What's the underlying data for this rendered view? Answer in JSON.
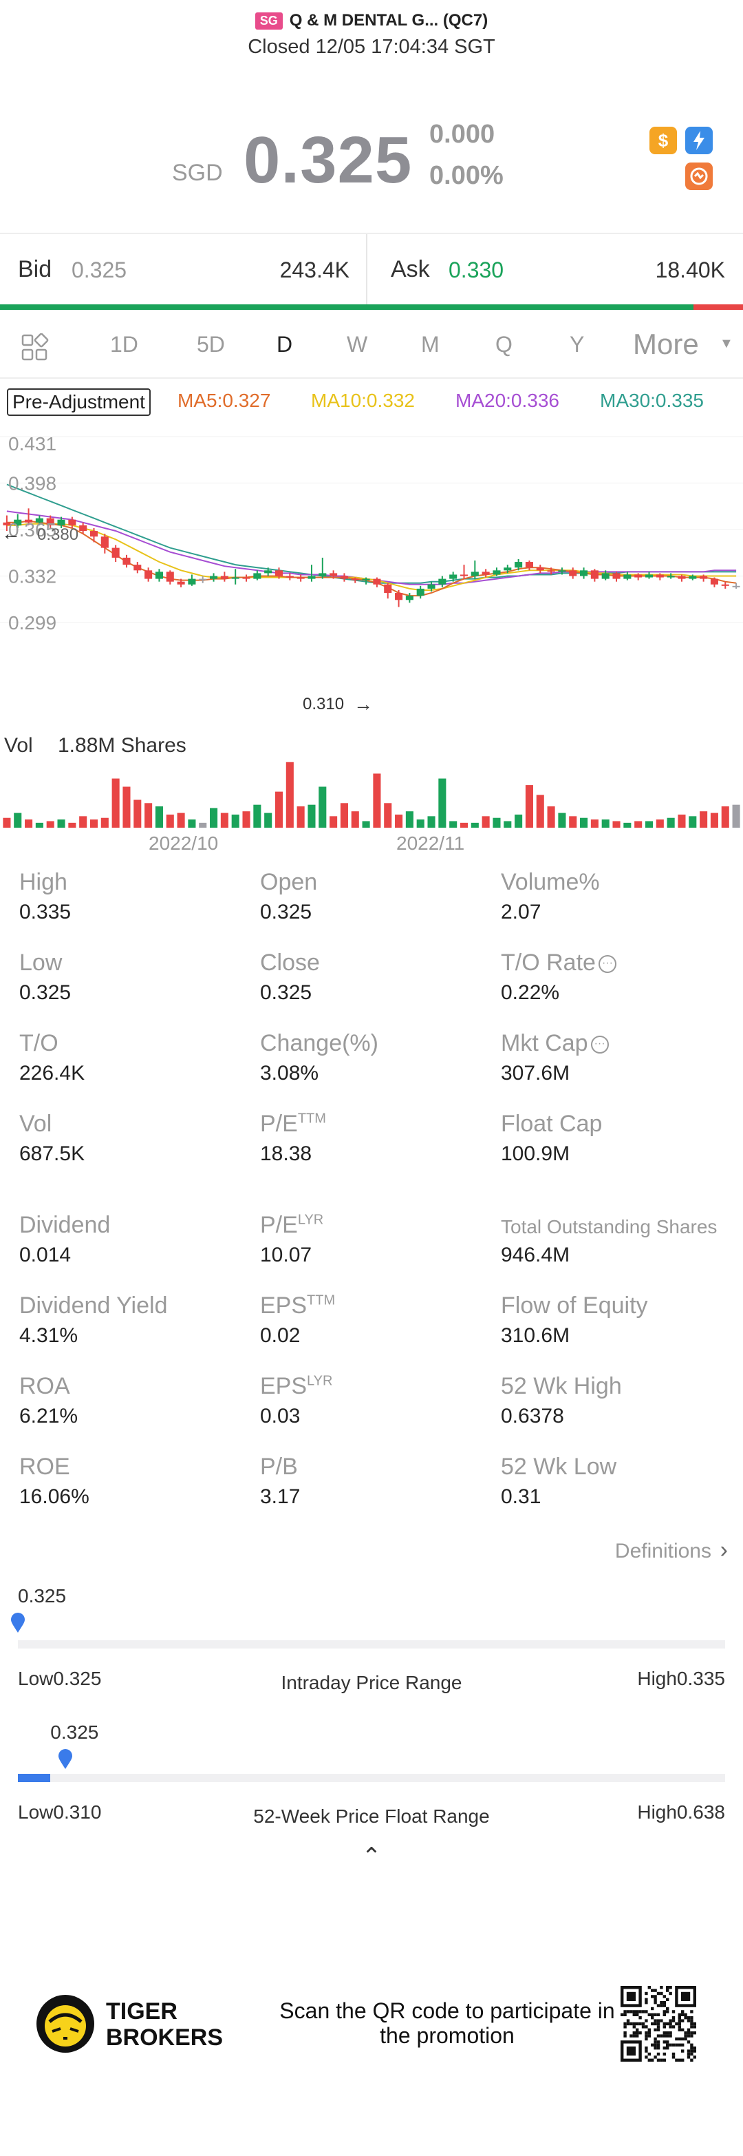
{
  "header": {
    "market": "SG",
    "name": "Q & M DENTAL G... (QC7)",
    "status": "Closed 12/05 17:04:34 SGT"
  },
  "quote": {
    "currency": "SGD",
    "price": "0.325",
    "change": "0.000",
    "change_pct": "0.00%"
  },
  "tool_icons": [
    "dollar-icon",
    "flash-icon",
    "swap-icon"
  ],
  "bidask": {
    "bid_label": "Bid",
    "bid_price": "0.325",
    "bid_vol": "243.4K",
    "ask_label": "Ask",
    "ask_price": "0.330",
    "ask_vol": "18.40K",
    "bid_share": 0.933
  },
  "tabs": [
    "1D",
    "5D",
    "D",
    "W",
    "M",
    "Q",
    "Y"
  ],
  "active_tab": "D",
  "more_tab": "More",
  "indicators": {
    "adjust": "Pre-Adjustment",
    "ma5": "MA5:0.327",
    "ma10": "MA10:0.332",
    "ma20": "MA20:0.336",
    "ma30": "MA30:0.335"
  },
  "chart_data": {
    "type": "candlestick",
    "y_ticks": [
      "0.431",
      "0.398",
      "0.365",
      "0.332",
      "0.299"
    ],
    "ylim": [
      0.299,
      0.431
    ],
    "high_marker": "0.380",
    "low_marker": "0.310",
    "x_ticks": [
      "2022/10",
      "2022/11"
    ],
    "volume_label": "Vol",
    "volume_value": "1.88M Shares",
    "colors": {
      "up": "#1aa35a",
      "down": "#e84545",
      "flat": "#a0a0a6",
      "ma5": "#e06c2a",
      "ma10": "#e8c21a",
      "ma20": "#a64ed3",
      "ma30": "#2f9e8f"
    },
    "candles": [
      [
        0.37,
        0.368,
        0.375,
        0.364
      ],
      [
        0.368,
        0.372,
        0.376,
        0.366
      ],
      [
        0.372,
        0.37,
        0.38,
        0.368
      ],
      [
        0.37,
        0.373,
        0.375,
        0.368
      ],
      [
        0.373,
        0.368,
        0.375,
        0.366
      ],
      [
        0.368,
        0.372,
        0.374,
        0.366
      ],
      [
        0.372,
        0.368,
        0.374,
        0.366
      ],
      [
        0.368,
        0.364,
        0.37,
        0.362
      ],
      [
        0.364,
        0.36,
        0.366,
        0.356
      ],
      [
        0.36,
        0.352,
        0.362,
        0.348
      ],
      [
        0.352,
        0.345,
        0.354,
        0.342
      ],
      [
        0.345,
        0.34,
        0.347,
        0.338
      ],
      [
        0.34,
        0.336,
        0.342,
        0.334
      ],
      [
        0.336,
        0.33,
        0.338,
        0.328
      ],
      [
        0.33,
        0.335,
        0.337,
        0.328
      ],
      [
        0.335,
        0.328,
        0.336,
        0.326
      ],
      [
        0.328,
        0.326,
        0.33,
        0.324
      ],
      [
        0.326,
        0.33,
        0.333,
        0.325
      ],
      [
        0.33,
        0.33,
        0.332,
        0.327
      ],
      [
        0.33,
        0.332,
        0.334,
        0.328
      ],
      [
        0.332,
        0.33,
        0.335,
        0.328
      ],
      [
        0.33,
        0.331,
        0.337,
        0.326
      ],
      [
        0.331,
        0.33,
        0.333,
        0.328
      ],
      [
        0.33,
        0.334,
        0.336,
        0.329
      ],
      [
        0.334,
        0.336,
        0.338,
        0.332
      ],
      [
        0.336,
        0.332,
        0.338,
        0.33
      ],
      [
        0.332,
        0.331,
        0.334,
        0.329
      ],
      [
        0.331,
        0.33,
        0.333,
        0.328
      ],
      [
        0.33,
        0.332,
        0.34,
        0.328
      ],
      [
        0.332,
        0.334,
        0.345,
        0.33
      ],
      [
        0.334,
        0.332,
        0.336,
        0.33
      ],
      [
        0.332,
        0.33,
        0.334,
        0.328
      ],
      [
        0.33,
        0.329,
        0.331,
        0.327
      ],
      [
        0.329,
        0.33,
        0.331,
        0.326
      ],
      [
        0.33,
        0.326,
        0.331,
        0.324
      ],
      [
        0.326,
        0.32,
        0.327,
        0.316
      ],
      [
        0.32,
        0.315,
        0.322,
        0.31
      ],
      [
        0.315,
        0.318,
        0.32,
        0.313
      ],
      [
        0.318,
        0.323,
        0.325,
        0.316
      ],
      [
        0.323,
        0.326,
        0.328,
        0.321
      ],
      [
        0.326,
        0.33,
        0.332,
        0.324
      ],
      [
        0.33,
        0.333,
        0.335,
        0.328
      ],
      [
        0.333,
        0.332,
        0.34,
        0.33
      ],
      [
        0.332,
        0.335,
        0.343,
        0.33
      ],
      [
        0.335,
        0.333,
        0.337,
        0.331
      ],
      [
        0.333,
        0.336,
        0.338,
        0.332
      ],
      [
        0.336,
        0.338,
        0.34,
        0.334
      ],
      [
        0.338,
        0.342,
        0.344,
        0.336
      ],
      [
        0.342,
        0.338,
        0.343,
        0.336
      ],
      [
        0.338,
        0.336,
        0.34,
        0.334
      ],
      [
        0.336,
        0.335,
        0.338,
        0.333
      ],
      [
        0.335,
        0.336,
        0.338,
        0.333
      ],
      [
        0.336,
        0.332,
        0.338,
        0.33
      ],
      [
        0.332,
        0.336,
        0.338,
        0.33
      ],
      [
        0.336,
        0.33,
        0.337,
        0.328
      ],
      [
        0.33,
        0.334,
        0.336,
        0.329
      ],
      [
        0.334,
        0.33,
        0.335,
        0.328
      ],
      [
        0.33,
        0.333,
        0.335,
        0.329
      ],
      [
        0.333,
        0.331,
        0.334,
        0.329
      ],
      [
        0.331,
        0.333,
        0.335,
        0.33
      ],
      [
        0.333,
        0.331,
        0.334,
        0.329
      ],
      [
        0.331,
        0.332,
        0.334,
        0.33
      ],
      [
        0.332,
        0.33,
        0.333,
        0.328
      ],
      [
        0.33,
        0.332,
        0.333,
        0.329
      ],
      [
        0.332,
        0.33,
        0.333,
        0.328
      ],
      [
        0.33,
        0.326,
        0.331,
        0.324
      ],
      [
        0.326,
        0.325,
        0.328,
        0.323
      ],
      [
        0.325,
        0.325,
        0.327,
        0.323
      ]
    ],
    "ma5": [
      0.37,
      0.37,
      0.371,
      0.37,
      0.369,
      0.368,
      0.366,
      0.362,
      0.357,
      0.352,
      0.347,
      0.342,
      0.338,
      0.335,
      0.332,
      0.33,
      0.329,
      0.329,
      0.329,
      0.33,
      0.33,
      0.331,
      0.331,
      0.332,
      0.332,
      0.332,
      0.331,
      0.331,
      0.331,
      0.331,
      0.331,
      0.331,
      0.33,
      0.329,
      0.327,
      0.324,
      0.32,
      0.318,
      0.318,
      0.32,
      0.323,
      0.327,
      0.33,
      0.332,
      0.333,
      0.334,
      0.335,
      0.337,
      0.338,
      0.338,
      0.337,
      0.336,
      0.335,
      0.334,
      0.333,
      0.333,
      0.332,
      0.332,
      0.332,
      0.332,
      0.332,
      0.332,
      0.331,
      0.331,
      0.331,
      0.33,
      0.328,
      0.327
    ],
    "ma10": [
      0.368,
      0.368,
      0.369,
      0.369,
      0.369,
      0.369,
      0.368,
      0.366,
      0.364,
      0.361,
      0.358,
      0.354,
      0.35,
      0.346,
      0.342,
      0.339,
      0.336,
      0.334,
      0.332,
      0.331,
      0.331,
      0.331,
      0.331,
      0.331,
      0.331,
      0.331,
      0.331,
      0.331,
      0.331,
      0.331,
      0.331,
      0.331,
      0.331,
      0.33,
      0.329,
      0.327,
      0.325,
      0.323,
      0.322,
      0.322,
      0.323,
      0.325,
      0.327,
      0.329,
      0.331,
      0.333,
      0.334,
      0.335,
      0.336,
      0.336,
      0.336,
      0.336,
      0.336,
      0.335,
      0.334,
      0.334,
      0.333,
      0.333,
      0.333,
      0.333,
      0.333,
      0.333,
      0.333,
      0.332,
      0.332,
      0.332,
      0.332,
      0.332
    ],
    "ma20": [
      0.378,
      0.377,
      0.376,
      0.375,
      0.374,
      0.373,
      0.372,
      0.37,
      0.368,
      0.366,
      0.364,
      0.361,
      0.358,
      0.355,
      0.352,
      0.349,
      0.347,
      0.345,
      0.343,
      0.341,
      0.339,
      0.338,
      0.337,
      0.336,
      0.335,
      0.334,
      0.334,
      0.333,
      0.333,
      0.333,
      0.332,
      0.332,
      0.331,
      0.33,
      0.329,
      0.328,
      0.327,
      0.326,
      0.326,
      0.326,
      0.326,
      0.327,
      0.327,
      0.328,
      0.329,
      0.33,
      0.331,
      0.332,
      0.333,
      0.334,
      0.334,
      0.335,
      0.335,
      0.335,
      0.335,
      0.335,
      0.335,
      0.335,
      0.335,
      0.335,
      0.335,
      0.335,
      0.335,
      0.335,
      0.335,
      0.336,
      0.336,
      0.336
    ],
    "ma30": [
      0.397,
      0.394,
      0.391,
      0.388,
      0.385,
      0.382,
      0.379,
      0.376,
      0.373,
      0.37,
      0.367,
      0.364,
      0.361,
      0.358,
      0.355,
      0.352,
      0.35,
      0.348,
      0.346,
      0.344,
      0.342,
      0.34,
      0.339,
      0.338,
      0.337,
      0.336,
      0.335,
      0.334,
      0.333,
      0.332,
      0.331,
      0.33,
      0.329,
      0.328,
      0.327,
      0.327,
      0.327,
      0.327,
      0.327,
      0.328,
      0.328,
      0.329,
      0.33,
      0.33,
      0.331,
      0.331,
      0.332,
      0.332,
      0.333,
      0.333,
      0.333,
      0.334,
      0.334,
      0.334,
      0.334,
      0.334,
      0.334,
      0.335,
      0.335,
      0.335,
      0.335,
      0.335,
      0.335,
      0.335,
      0.335,
      0.335,
      0.335,
      0.335
    ],
    "volume": [
      0.6,
      0.9,
      0.5,
      0.3,
      0.4,
      0.5,
      0.3,
      0.7,
      0.5,
      0.6,
      3.0,
      2.5,
      1.7,
      1.5,
      1.3,
      0.8,
      0.9,
      0.5,
      0.3,
      1.2,
      0.9,
      0.8,
      1.0,
      1.4,
      0.9,
      2.2,
      4.0,
      1.3,
      1.4,
      2.5,
      0.7,
      1.5,
      1.0,
      0.4,
      3.3,
      1.5,
      0.8,
      1.0,
      0.5,
      0.7,
      3.0,
      0.4,
      0.3,
      0.3,
      0.7,
      0.6,
      0.4,
      0.8,
      2.6,
      2.0,
      1.3,
      0.9,
      0.7,
      0.6,
      0.5,
      0.5,
      0.4,
      0.3,
      0.4,
      0.4,
      0.5,
      0.6,
      0.8,
      0.7,
      1.0,
      0.9,
      1.3,
      1.4
    ],
    "vmax": 4.2
  },
  "stats": [
    {
      "label": "High",
      "sup": "",
      "value": "0.335",
      "info": false,
      "small": false
    },
    {
      "label": "Open",
      "sup": "",
      "value": "0.325",
      "info": false,
      "small": false
    },
    {
      "label": "Volume%",
      "sup": "",
      "value": "2.07",
      "info": false,
      "small": false
    },
    {
      "label": "Low",
      "sup": "",
      "value": "0.325",
      "info": false,
      "small": false
    },
    {
      "label": "Close",
      "sup": "",
      "value": "0.325",
      "info": false,
      "small": false
    },
    {
      "label": "T/O Rate",
      "sup": "",
      "value": "0.22%",
      "info": true,
      "small": false
    },
    {
      "label": "T/O",
      "sup": "",
      "value": "226.4K",
      "info": false,
      "small": false
    },
    {
      "label": "Change(%)",
      "sup": "",
      "value": "3.08%",
      "info": false,
      "small": false
    },
    {
      "label": "Mkt Cap",
      "sup": "",
      "value": "307.6M",
      "info": true,
      "small": false
    },
    {
      "label": "Vol",
      "sup": "",
      "value": "687.5K",
      "info": false,
      "small": false
    },
    {
      "label": "P/E",
      "sup": "TTM",
      "value": "18.38",
      "info": false,
      "small": false
    },
    {
      "label": "Float Cap",
      "sup": "",
      "value": "100.9M",
      "info": false,
      "small": false
    },
    {
      "label": "Dividend",
      "sup": "",
      "value": "0.014",
      "info": false,
      "small": false
    },
    {
      "label": "P/E",
      "sup": "LYR",
      "value": "10.07",
      "info": false,
      "small": false
    },
    {
      "label": "Total Outstanding Shares",
      "sup": "",
      "value": "946.4M",
      "info": false,
      "small": true
    },
    {
      "label": "Dividend Yield",
      "sup": "",
      "value": "4.31%",
      "info": false,
      "small": false
    },
    {
      "label": "EPS",
      "sup": "TTM",
      "value": "0.02",
      "info": false,
      "small": false
    },
    {
      "label": "Flow of Equity",
      "sup": "",
      "value": "310.6M",
      "info": false,
      "small": false
    },
    {
      "label": "ROA",
      "sup": "",
      "value": "6.21%",
      "info": false,
      "small": false
    },
    {
      "label": "EPS",
      "sup": "LYR",
      "value": "0.03",
      "info": false,
      "small": false
    },
    {
      "label": "52 Wk High",
      "sup": "",
      "value": "0.6378",
      "info": false,
      "small": false
    },
    {
      "label": "ROE",
      "sup": "",
      "value": "16.06%",
      "info": false,
      "small": false
    },
    {
      "label": "P/B",
      "sup": "",
      "value": "3.17",
      "info": false,
      "small": false
    },
    {
      "label": "52 Wk Low",
      "sup": "",
      "value": "0.31",
      "info": false,
      "small": false
    }
  ],
  "definitions": "Definitions",
  "intraday": {
    "current": "0.325",
    "low": "Low0.325",
    "title": "Intraday Price Range",
    "high": "High0.335",
    "position": 0.0,
    "fill": 0.0
  },
  "week52": {
    "current": "0.325",
    "low": "Low0.310",
    "title": "52-Week Price Float Range",
    "high": "High0.638",
    "position": 0.046,
    "fill": 0.046
  },
  "footer": {
    "brand": "TIGER BROKERS",
    "promo": "Scan the QR code to participate in the promotion"
  }
}
